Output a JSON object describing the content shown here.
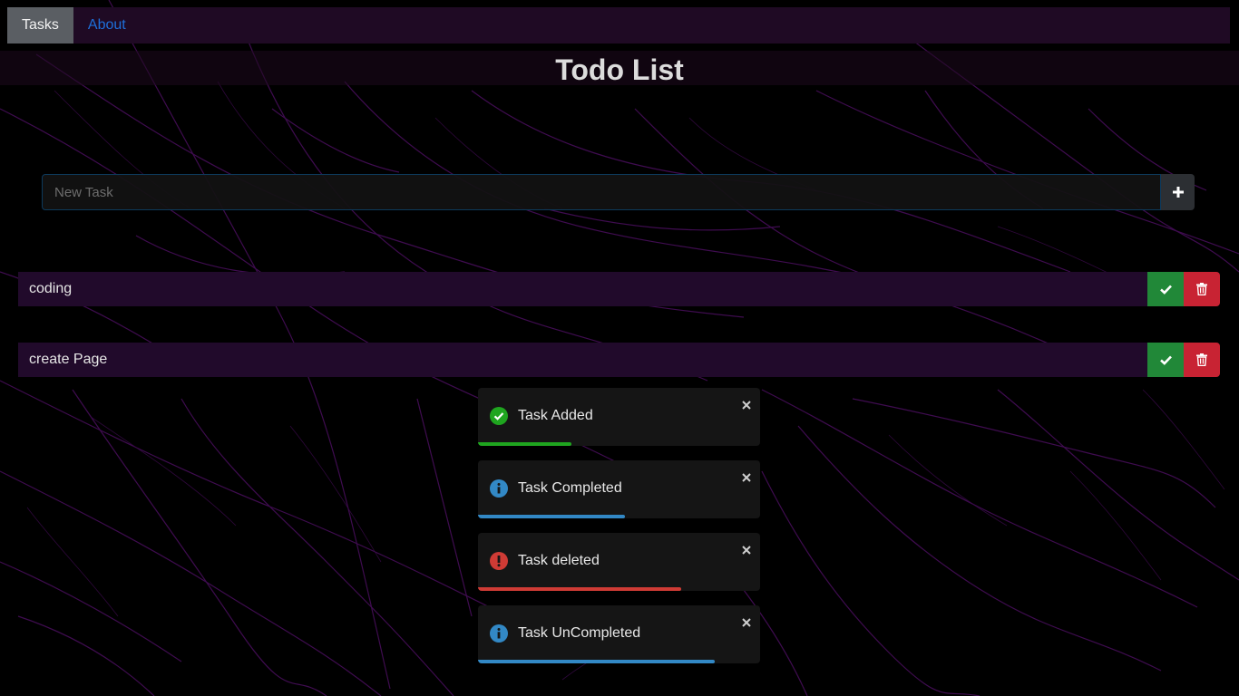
{
  "nav": {
    "tasks_label": "Tasks",
    "about_label": "About"
  },
  "page": {
    "title": "Todo List"
  },
  "new_task": {
    "placeholder": "New Task",
    "value": "",
    "add_icon": "plus-icon"
  },
  "tasks": [
    {
      "label": "coding",
      "complete_icon": "check-icon",
      "delete_icon": "trash-icon"
    },
    {
      "label": "create Page",
      "complete_icon": "check-icon",
      "delete_icon": "trash-icon"
    }
  ],
  "toasts": [
    {
      "text": "Task Added",
      "type": "success",
      "icon": "check-circle-icon",
      "color": "#1fa51f",
      "progress": 0.33
    },
    {
      "text": "Task Completed",
      "type": "info",
      "icon": "info-circle-icon",
      "color": "#3288c5",
      "progress": 0.52
    },
    {
      "text": "Task deleted",
      "type": "error",
      "icon": "exclamation-circle-icon",
      "color": "#cf3b35",
      "progress": 0.72
    },
    {
      "text": "Task UnCompleted",
      "type": "info",
      "icon": "info-circle-icon",
      "color": "#3288c5",
      "progress": 0.84
    }
  ],
  "colors": {
    "navbar_bg": "#1f0a24",
    "task_bg": "#210a2b",
    "complete_green": "#218838",
    "delete_red": "#c82333",
    "background_pattern": "#4b1060"
  }
}
